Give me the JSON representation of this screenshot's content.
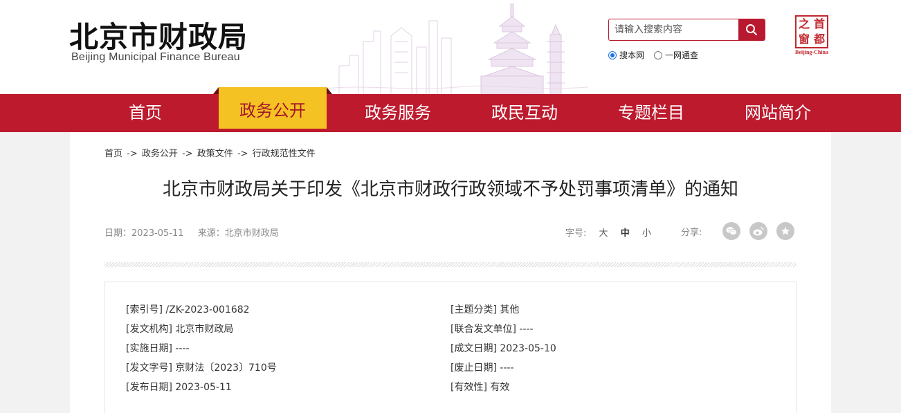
{
  "header": {
    "logo_cn": "北京市财政局",
    "logo_en": "Beijing Municipal Finance Bureau",
    "search_placeholder": "请输入搜索内容",
    "search_scope": [
      {
        "label": "搜本网",
        "checked": true
      },
      {
        "label": "一网通查",
        "checked": false
      }
    ],
    "capital_logo": {
      "chars": [
        "之",
        "首",
        "窗",
        "都"
      ],
      "en": "Beijing-China"
    }
  },
  "nav": {
    "items": [
      {
        "label": "首页",
        "active": false
      },
      {
        "label": "政务公开",
        "active": true
      },
      {
        "label": "政务服务",
        "active": false
      },
      {
        "label": "政民互动",
        "active": false
      },
      {
        "label": "专题栏目",
        "active": false
      },
      {
        "label": "网站简介",
        "active": false
      }
    ]
  },
  "breadcrumb": [
    "首页",
    "->",
    "政务公开",
    "->",
    "政策文件",
    "->",
    "行政规范性文件"
  ],
  "article": {
    "title": "北京市财政局关于印发《北京市财政行政领域不予处罚事项清单》的通知",
    "date_label": "日期：",
    "date": "2023-05-11",
    "source_label": "来源：",
    "source": "北京市财政局",
    "fontsize_label": "字号:",
    "fontsize_options": [
      "大",
      "中",
      "小"
    ],
    "share_label": "分享:",
    "share_icons": [
      "wechat-icon",
      "weibo-icon",
      "favorite-star-icon"
    ]
  },
  "info": {
    "left": [
      {
        "label": "[索引号]",
        "value": "/ZK-2023-001682"
      },
      {
        "label": "[发文机构]",
        "value": "北京市财政局"
      },
      {
        "label": "[实施日期]",
        "value": "----"
      },
      {
        "label": "[发文字号]",
        "value": "京财法〔2023〕710号"
      },
      {
        "label": "[发布日期]",
        "value": "2023-05-11"
      }
    ],
    "right": [
      {
        "label": "[主题分类]",
        "value": "其他"
      },
      {
        "label": "[联合发文单位]",
        "value": "----"
      },
      {
        "label": "[成文日期]",
        "value": "2023-05-10"
      },
      {
        "label": "[废止日期]",
        "value": "----"
      },
      {
        "label": "[有效性]",
        "value": "有效"
      }
    ]
  },
  "colors": {
    "nav_red": "#bd1a2e",
    "active_yellow": "#f5c224",
    "brand_red": "#b8192f"
  }
}
